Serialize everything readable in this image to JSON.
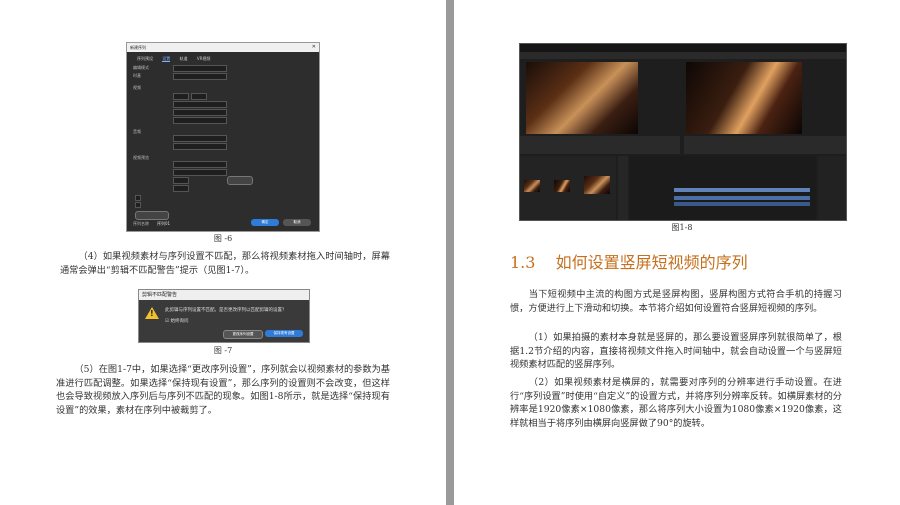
{
  "left_page": {
    "fig6_caption": "图 -6",
    "para4": "（4）如果视频素材与序列设置不匹配，那么将视频素材拖入时间轴时，屏幕通常会弹出“剪辑不匹配警告”提示（见图1-7）。",
    "warning_dialog": {
      "title": "剪辑不匹配警告",
      "message": "此剪辑与序列设置不匹配。是否更改序列以匹配剪辑的设置？",
      "checkbox": "始终询问",
      "change_button": "更改序列设置",
      "keep_button": "保持现有设置"
    },
    "fig7_caption": "图 -7",
    "para5": "（5）在图1-7中，如果选择“更改序列设置”，序列就会以视频素材的参数为基准进行匹配调整。如果选择“保持现有设置”，那么序列的设置则不会改变，但这样也会导致视频放入序列后与序列不匹配的现象。如图1-8所示，就是选择“保持现有设置”的效果，素材在序列中被裁剪了。",
    "settings_dialog": {
      "title": "新建序列",
      "tabs": [
        "序列预设",
        "设置",
        "轨道",
        "VR视频"
      ],
      "active_tab": 1,
      "sections": [
        "编辑模式",
        "时基",
        "视频",
        "音频",
        "视频预览"
      ],
      "sequence_name_label": "序列名称",
      "sequence_name": "序列01",
      "ok": "确定",
      "cancel": "取消"
    }
  },
  "right_page": {
    "fig8_caption": "图1-8",
    "section_number": "1.3",
    "section_title": "如何设置竖屏短视频的序列",
    "intro": "当下短视频中主流的构图方式是竖屏构图，竖屏构图方式符合手机的持握习惯，方便进行上下滑动和切换。本节将介绍如何设置符合竖屏短视频的序列。",
    "para1": "（1）如果拍摄的素材本身就是竖屏的，那么要设置竖屏序列就很简单了，根据1.2节介绍的内容，直接将视频文件拖入时间轴中，就会自动设置一个与竖屏短视频素材匹配的竖屏序列。",
    "para2": "（2）如果视频素材是横屏的，就需要对序列的分辨率进行手动设置。在进行“序列设置”时使用“自定义”的设置方式，并将序列分辨率反转。如横屏素材的分辨率是1920像素×1080像素，那么将序列大小设置为1080像素×1920像素，这样就相当于将序列由横屏向竖屏做了90°的旋转。"
  },
  "colors": {
    "heading": "#c5701e",
    "gutter": "#9a9a9a",
    "warning": "#f2c12e",
    "accent_button": "#2f7bd8"
  }
}
